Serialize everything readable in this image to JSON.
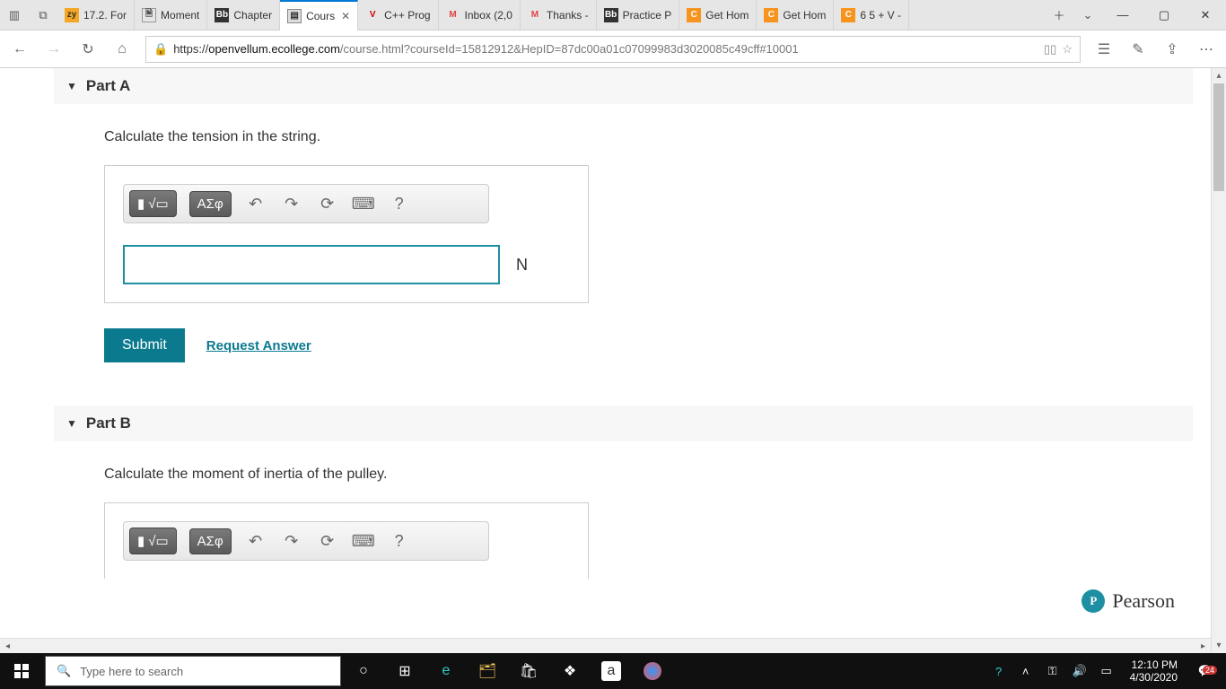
{
  "browser": {
    "tabs": [
      {
        "favicon": "zy",
        "label": "17.2. For"
      },
      {
        "favicon": "w",
        "label": "Moment"
      },
      {
        "favicon": "bb",
        "label": "Chapter "
      },
      {
        "favicon": "note",
        "label": "Cours"
      },
      {
        "favicon": "v",
        "label": "C++ Prog"
      },
      {
        "favicon": "m",
        "label": "Inbox (2,0"
      },
      {
        "favicon": "m",
        "label": "Thanks -"
      },
      {
        "favicon": "bb",
        "label": "Practice P"
      },
      {
        "favicon": "c",
        "label": "Get Hom"
      },
      {
        "favicon": "c",
        "label": "Get Hom"
      },
      {
        "favicon": "c",
        "label": "6 5 + V -"
      }
    ],
    "url_host": "openvellum.ecollege.com",
    "url_prefix": "https://",
    "url_path": "/course.html?courseId=15812912&HepID=87dc00a01c07099983d3020085c49cff#10001"
  },
  "page": {
    "partA": {
      "title": "Part A",
      "question": "Calculate the tension in the string.",
      "unit": "N",
      "symbols_label": "ΑΣφ",
      "help_label": "?"
    },
    "partB": {
      "title": "Part B",
      "question": "Calculate the moment of inertia of the pulley.",
      "symbols_label": "ΑΣφ",
      "help_label": "?"
    },
    "submit_label": "Submit",
    "request_label": "Request Answer",
    "pearson_label": "Pearson"
  },
  "taskbar": {
    "search_placeholder": "Type here to search",
    "time": "12:10 PM",
    "date": "4/30/2020",
    "notif_count": "24"
  }
}
